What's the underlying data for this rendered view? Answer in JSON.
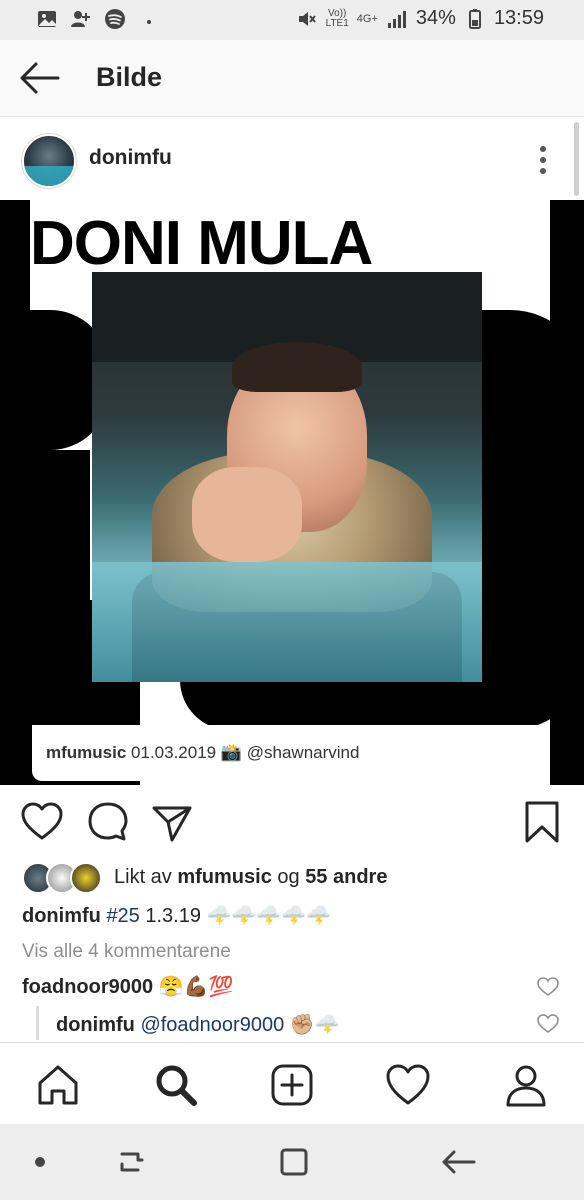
{
  "status_bar": {
    "network_top": "Vo))",
    "network_bottom": "LTE1",
    "network_type": "4G+",
    "battery": "34%",
    "time": "13:59",
    "icons": [
      "gallery-icon",
      "add-contact-icon",
      "spotify-icon",
      "dot-icon",
      "mute-icon",
      "signal-icon",
      "battery-icon"
    ]
  },
  "header": {
    "title": "Bilde",
    "back_icon": "back-arrow-icon"
  },
  "post": {
    "username": "donimfu",
    "cover_title": "DONI MULA",
    "credit_user": "mfumusic",
    "credit_date": "01.03.2019",
    "credit_emoji": "📸",
    "credit_handle": "@shawnarvind",
    "likes_prefix": "Likt av ",
    "likes_user": "mfumusic",
    "likes_mid": " og ",
    "likes_count": "55 andre",
    "caption_user": "donimfu",
    "caption_tag": "#25",
    "caption_text": " 1.3.19 🌩️🌩️🌩️🌩️🌩️",
    "view_comments": "Vis alle 4 kommentarene",
    "comments": [
      {
        "user": "foadnoor9000",
        "text": " 😤💪🏾💯",
        "mention": ""
      },
      {
        "user": "donimfu",
        "mention": "@foadnoor9000",
        "text": " ✊🏼🌩️"
      }
    ]
  },
  "bottom_nav": [
    "home-icon",
    "search-icon",
    "new-post-icon",
    "activity-heart-icon",
    "profile-icon"
  ],
  "system_nav": [
    "dot-icon",
    "recent-apps-icon",
    "home-square-icon",
    "back-icon"
  ],
  "colors": {
    "accent_link": "#1a3a6b",
    "muted": "#8e8e8e",
    "photo_teal": "#6fb2c0"
  }
}
